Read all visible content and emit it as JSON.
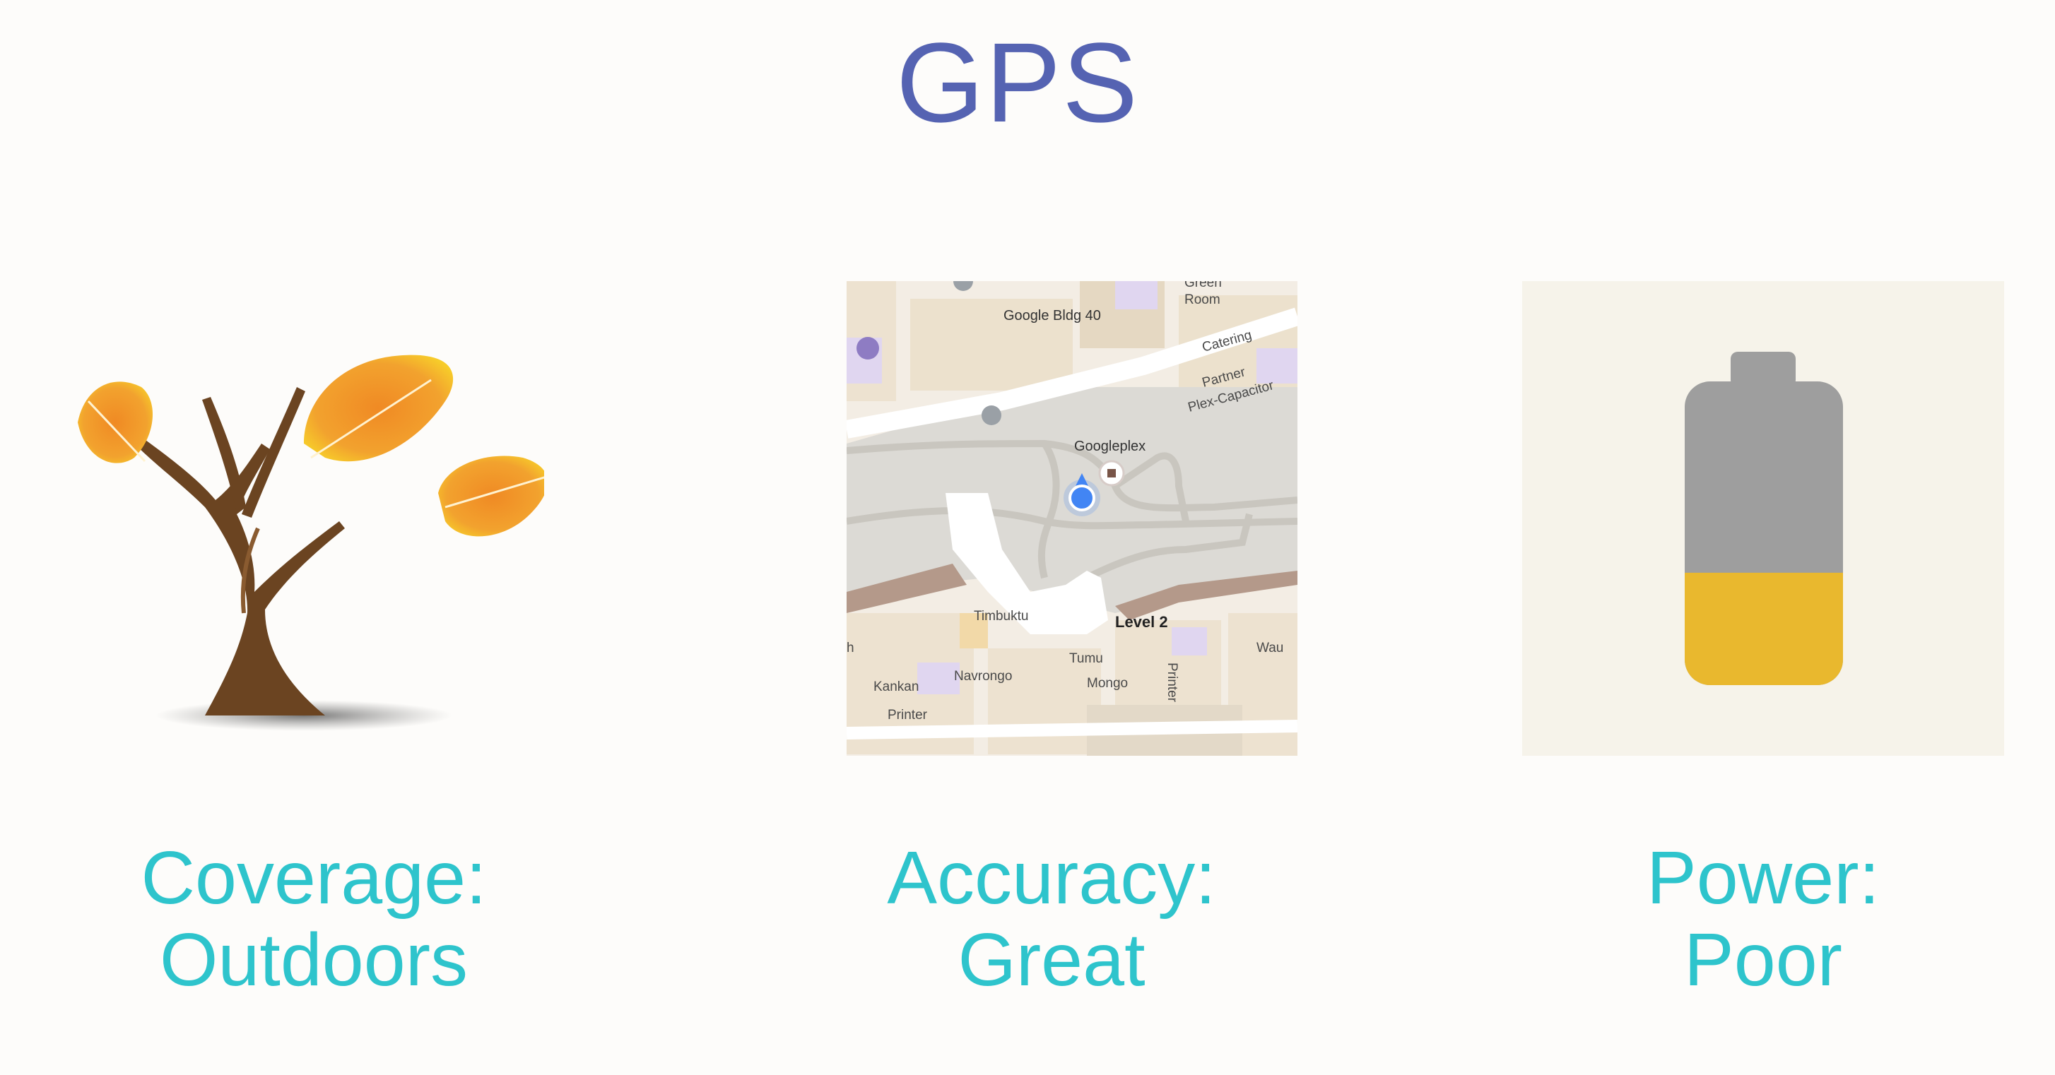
{
  "slide": {
    "title": "GPS",
    "title_color": "#5563b2",
    "caption_color": "#2ec4cc"
  },
  "coverage": {
    "icon": "tree-icon",
    "label": "Coverage:",
    "value": "Outdoors"
  },
  "accuracy": {
    "icon": "map-icon",
    "label": "Accuracy:",
    "value": "Great",
    "map_labels": {
      "green_room_1": "Green",
      "green_room_2": "Room",
      "bldg": "Google Bldg 40",
      "catering": "Catering",
      "partner": "Partner",
      "plex": "Plex-Capacitor",
      "googleplex": "Googleplex",
      "timbuktu": "Timbuktu",
      "level": "Level 2",
      "wau": "Wau",
      "tumu": "Tumu",
      "navrongo": "Navrongo",
      "kankan": "Kankan",
      "mongo": "Mongo",
      "printer_1": "Printer",
      "printer_2": "Printer",
      "h": "h"
    }
  },
  "power": {
    "icon": "battery-icon",
    "label": "Power:",
    "value": "Poor",
    "battery_level": 0.37,
    "battery_fill_color": "#e9b82e",
    "battery_empty_color": "#9e9e9e"
  }
}
